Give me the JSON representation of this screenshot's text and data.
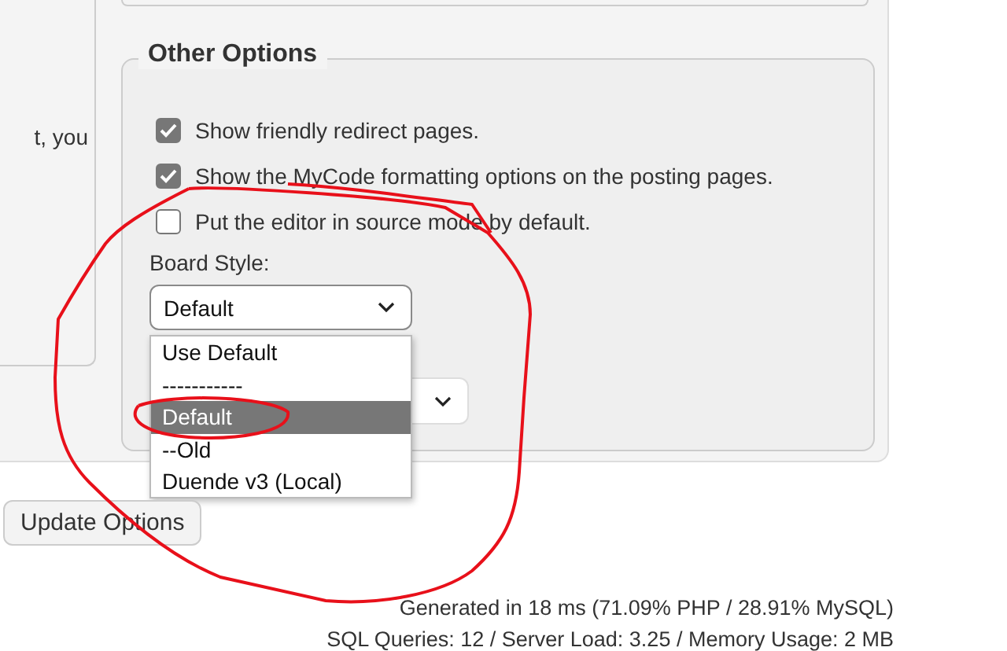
{
  "sidebar": {
    "text": "t, you"
  },
  "other_options": {
    "legend": "Other Options",
    "checkboxes": [
      {
        "label": "Show friendly redirect pages.",
        "checked": true
      },
      {
        "label": "Show the MyCode formatting options on the posting pages.",
        "checked": true
      },
      {
        "label": "Put the editor in source mode by default.",
        "checked": false
      }
    ],
    "board_style": {
      "label": "Board Style:",
      "value": "Default",
      "expanded": true,
      "options": [
        {
          "label": "Use Default",
          "selected": false
        },
        {
          "label": "-----------",
          "selected": false
        },
        {
          "label": "Default",
          "selected": true
        },
        {
          "label": "--Old",
          "selected": false
        },
        {
          "label": "Duende v3 (Local)",
          "selected": false
        }
      ]
    }
  },
  "update_button": "Update Options",
  "footer": [
    "Generated in 18 ms (71.09% PHP / 28.91% MySQL)",
    "SQL Queries: 12 / Server Load: 3.25 / Memory Usage: 2 MB"
  ]
}
